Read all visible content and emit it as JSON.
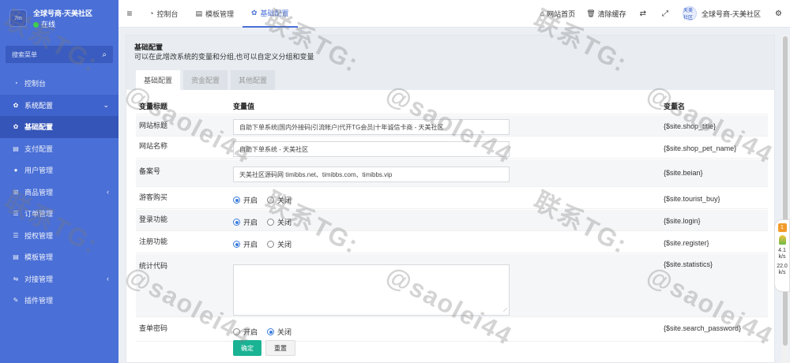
{
  "sidebar": {
    "brand_name": "全球号商-天美社区",
    "brand_logo": "7m",
    "status": "在线",
    "search_placeholder": "搜索菜单",
    "items": [
      {
        "label": "控制台",
        "icon": "dashboard-icon",
        "glyph": "◔"
      },
      {
        "label": "系统配置",
        "icon": "gear-icon",
        "glyph": "✿",
        "arrow": "⌄"
      },
      {
        "label": "基础配置",
        "icon": "gear-icon",
        "glyph": "✿"
      },
      {
        "label": "支付配置",
        "icon": "list-icon",
        "glyph": "▤"
      },
      {
        "label": "用户管理",
        "icon": "user-icon",
        "glyph": "●"
      },
      {
        "label": "商品管理",
        "icon": "cart-icon",
        "glyph": "⊞",
        "arrow": "‹"
      },
      {
        "label": "订单管理",
        "icon": "list-icon",
        "glyph": "☰"
      },
      {
        "label": "授权管理",
        "icon": "list-icon",
        "glyph": "☰"
      },
      {
        "label": "模板管理",
        "icon": "template-icon",
        "glyph": "▤"
      },
      {
        "label": "对接管理",
        "icon": "sliders-icon",
        "glyph": "⇋",
        "arrow": "‹"
      },
      {
        "label": "插件管理",
        "icon": "wrench-icon",
        "glyph": "✎"
      }
    ]
  },
  "topbar": {
    "menu_glyph": "≡",
    "tabs": [
      {
        "label": "控制台",
        "glyph": "◔"
      },
      {
        "label": "模板管理",
        "glyph": "▤"
      },
      {
        "label": "基础配置",
        "glyph": "✿"
      }
    ],
    "home_label": "网站首页",
    "home_glyph": "⌂",
    "clear_label": "清除缓存",
    "clear_glyph": "🗑",
    "translate_glyph": "⇄",
    "fullscreen_glyph": "⤢",
    "user_name": "全球号商-天美社区",
    "avatar_text": "天美社区",
    "settings_glyph": "⚙"
  },
  "panel": {
    "title": "基础配置",
    "desc": "可以在此增改系统的变量和分组,也可以自定义分组和变量",
    "tabs": [
      "基础配置",
      "资金配置",
      "其他配置"
    ]
  },
  "table": {
    "headers": [
      "变量标题",
      "变量值",
      "变量名"
    ],
    "rows": [
      {
        "title": "网站标题",
        "value": "自助下单系统|国内外接码|引流帐户|代开TG会员|十年诚信卡商 - 天美社区",
        "name": "{$site.shop_title}"
      },
      {
        "title": "网站名称",
        "value": "自助下单系统 - 天美社区",
        "name": "{$site.shop_pet_name}"
      },
      {
        "title": "备案号",
        "value": "天美社区源码网 timibbs.net、timibbs.com、timibbs.vip",
        "name": "{$site.beian}"
      },
      {
        "title": "游客购买",
        "on": "开启",
        "off": "关闭",
        "selected": "on",
        "name": "{$site.tourist_buy}"
      },
      {
        "title": "登录功能",
        "on": "开启",
        "off": "关闭",
        "selected": "on",
        "name": "{$site.login}"
      },
      {
        "title": "注册功能",
        "on": "开启",
        "off": "关闭",
        "selected": "on",
        "name": "{$site.register}"
      },
      {
        "title": "统计代码",
        "value": "",
        "name": "{$site.statistics}"
      },
      {
        "title": "查单密码",
        "on": "开启",
        "off": "关闭",
        "selected": "off",
        "name": "{$site.search_password}"
      }
    ],
    "submit_label": "确定",
    "reset_label": "重置"
  },
  "widget": {
    "badge": "1",
    "stat1": "4.1",
    "stat1_sub": "k/s",
    "stat2": "22.0",
    "stat2_sub": "k/s"
  },
  "watermark": {
    "line1": "联系TG:",
    "line2": "@saolei44"
  },
  "colors": {
    "sidebar": "#4a6fd6",
    "accent": "#4a6fd6",
    "confirm": "#1ab394",
    "radio": "#3b7ddd"
  }
}
